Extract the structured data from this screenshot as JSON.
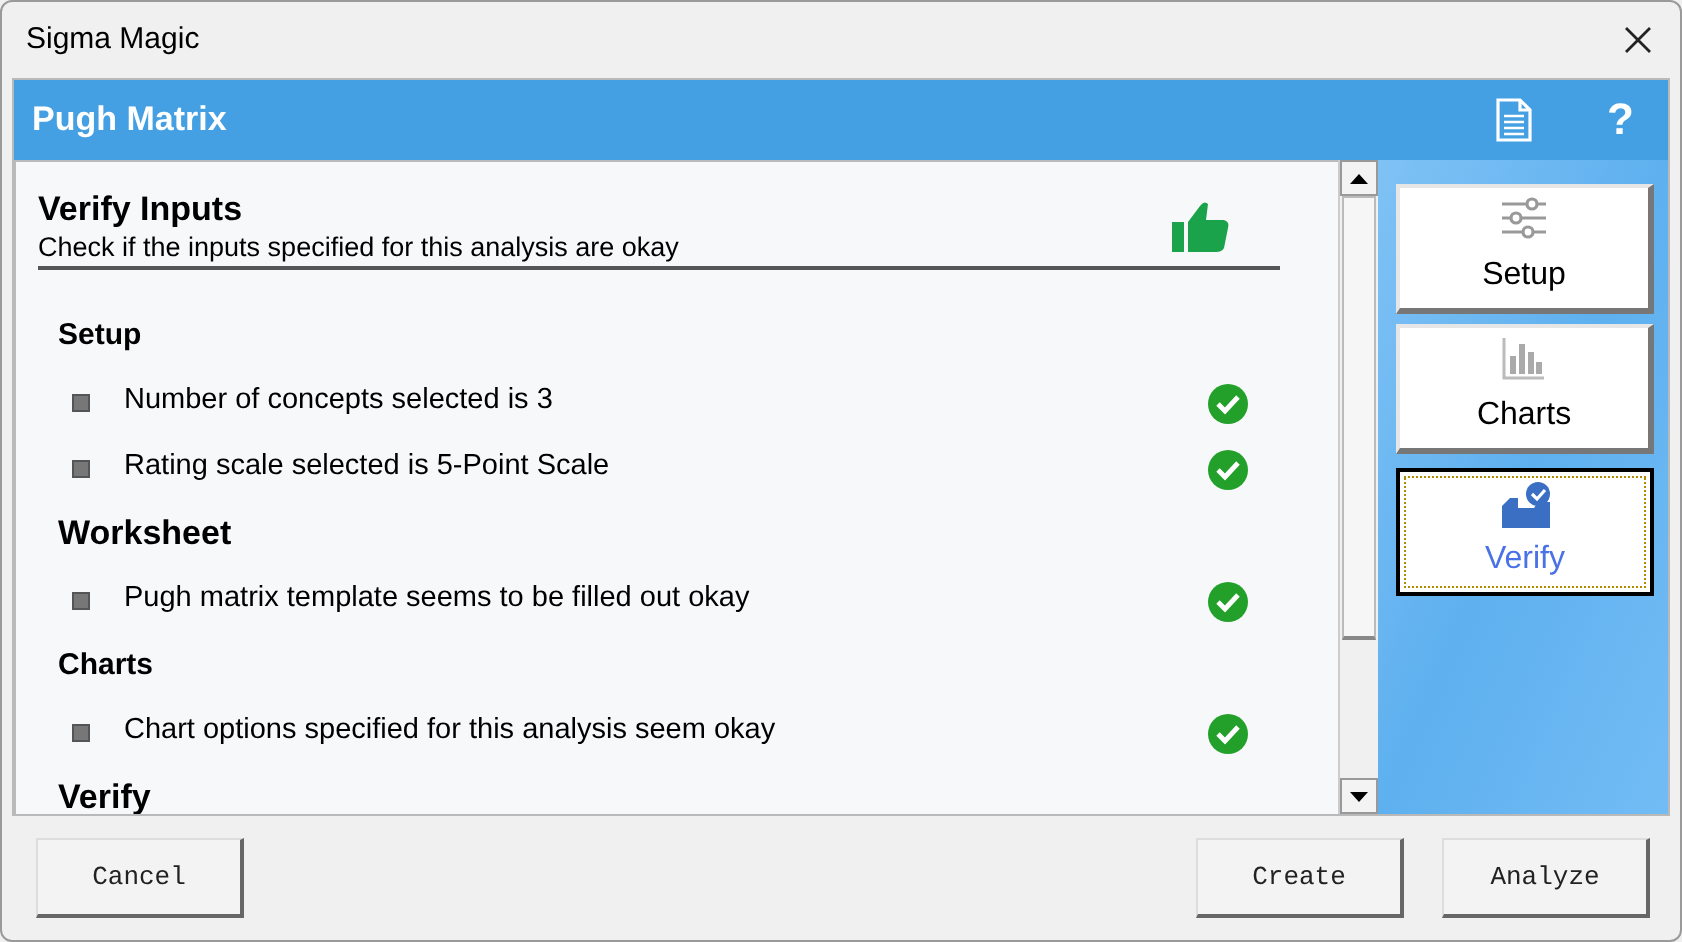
{
  "window": {
    "title": "Sigma Magic"
  },
  "header": {
    "title": "Pugh Matrix",
    "help": "?"
  },
  "panel": {
    "title": "Verify Inputs",
    "subtitle": "Check if the inputs specified for this analysis are okay",
    "sections": [
      {
        "title": "Setup",
        "items": [
          {
            "text": "Number of concepts selected is 3",
            "ok": true
          },
          {
            "text": "Rating scale selected is 5-Point Scale",
            "ok": true
          }
        ]
      },
      {
        "title": "Worksheet",
        "items": [
          {
            "text": "Pugh matrix template seems to be filled out okay",
            "ok": true
          }
        ]
      },
      {
        "title": "Charts",
        "items": [
          {
            "text": "Chart options specified for this analysis seem okay",
            "ok": true
          }
        ]
      },
      {
        "title": "Verify"
      }
    ]
  },
  "nav": [
    {
      "label": "Setup",
      "kind": "setup",
      "selected": false
    },
    {
      "label": "Charts",
      "kind": "charts",
      "selected": false
    },
    {
      "label": "Verify",
      "kind": "verify",
      "selected": true
    }
  ],
  "buttons": [
    {
      "label": "Cancel",
      "kind": "cancel"
    },
    {
      "label": "Create",
      "kind": "action"
    },
    {
      "label": "Analyze",
      "kind": "action"
    }
  ]
}
